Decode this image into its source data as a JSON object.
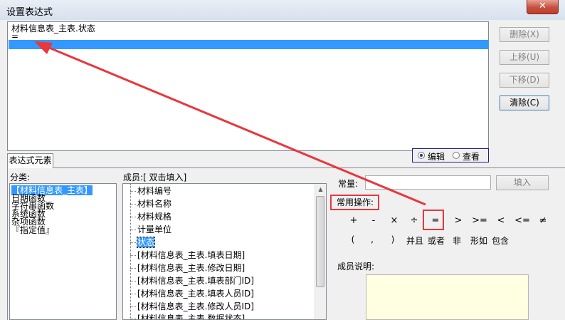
{
  "window": {
    "title": "设置表达式"
  },
  "expression": {
    "lines": [
      "材料信息表_主表.状态",
      "="
    ]
  },
  "side_buttons": {
    "delete": "删除(X)",
    "move_up": "上移(U)",
    "move_down": "下移(D)",
    "clear": "清除(C)"
  },
  "tab": {
    "label": "表达式元素"
  },
  "mode": {
    "edit": "编辑",
    "view": "查看",
    "selected": "编辑"
  },
  "category": {
    "label": "分类:",
    "items": [
      "【材料信息表_主表】",
      "日期函数",
      "字符串函数",
      "系统函数",
      "杂项函数",
      "『指定值』"
    ]
  },
  "members": {
    "label": "成员:[ 双击填入]",
    "items": [
      "材料编号",
      "材料名称",
      "材料规格",
      "计量单位",
      "状态",
      "[材料信息表_主表.填表日期]",
      "[材料信息表_主表.修改日期]",
      "[材料信息表_主表.填表部门ID]",
      "[材料信息表_主表.填表人员ID]",
      "[材料信息表_主表.修改人员ID]",
      "[材料信息表_主表.数据状态]"
    ]
  },
  "constant": {
    "label": "常量:",
    "value": "",
    "fill_button": "填入"
  },
  "operations": {
    "label": "常用操作:",
    "row1": [
      "+",
      "-",
      "×",
      "÷",
      "=",
      ">",
      ">=",
      "<",
      "<=",
      "≠"
    ],
    "row2": [
      "(",
      ",",
      ")",
      "并且",
      "或者",
      "非",
      "形如",
      "包含"
    ]
  },
  "member_description": {
    "label": "成员说明:",
    "value": ""
  },
  "colors": {
    "selection": "#3399ff",
    "highlight_red": "#e8373d",
    "desc_bg": "#ffffe1"
  }
}
